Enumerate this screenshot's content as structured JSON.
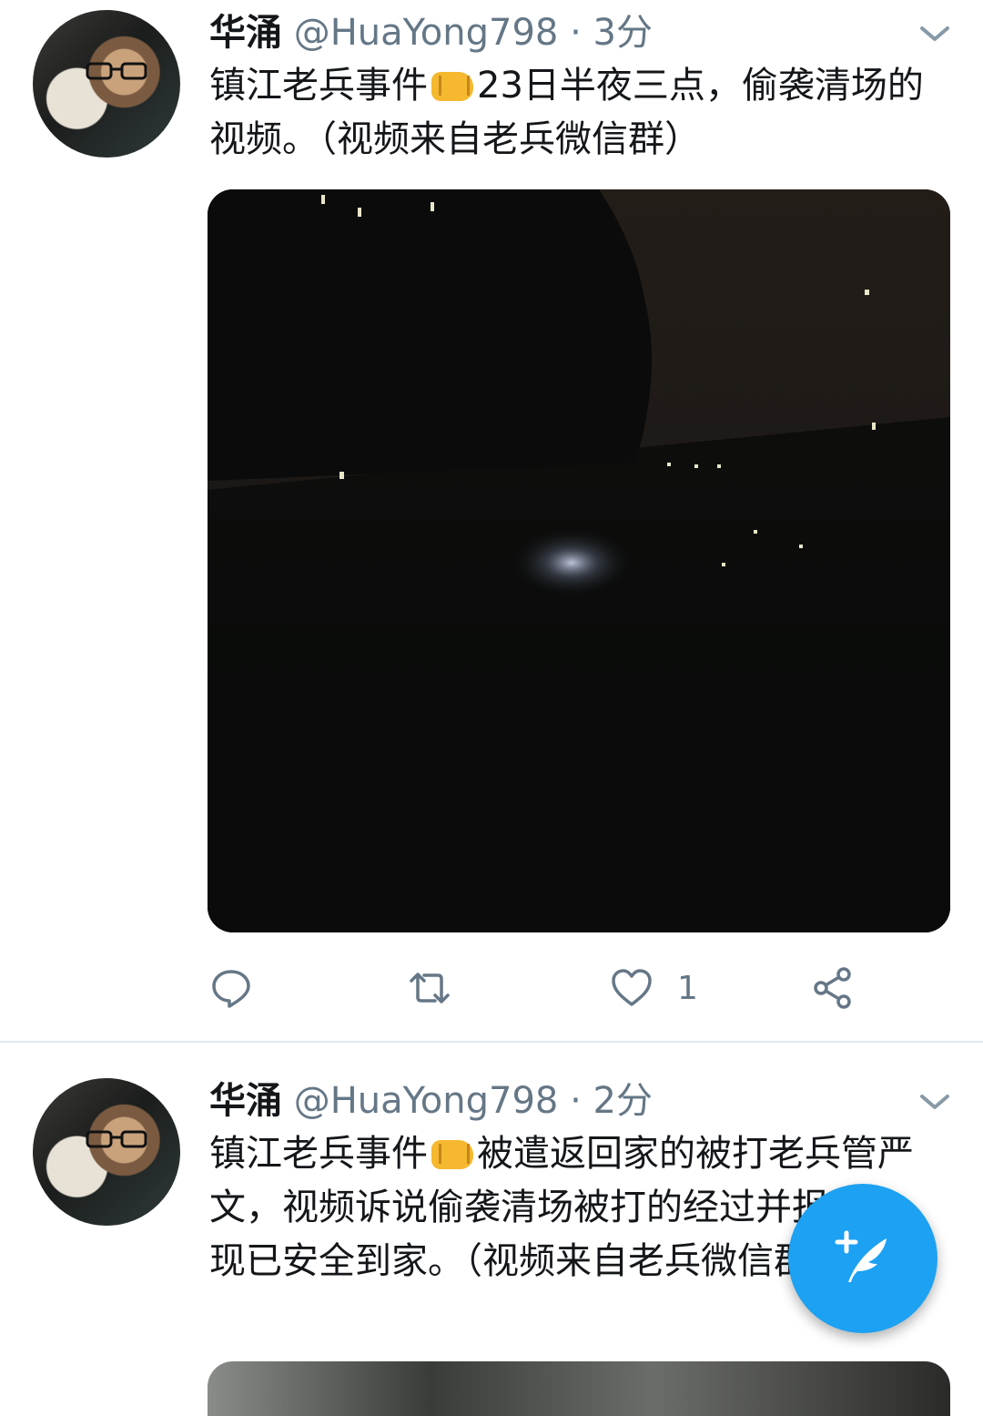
{
  "tweets": [
    {
      "name": "华涌",
      "handle": "@HuaYong798",
      "separator": "·",
      "time": "3分",
      "text_before": "镇江老兵事件",
      "text_after": "23日半夜三点，偷袭清场的视频。（视频来自老兵微信群）",
      "emoji": "fist-icon",
      "like_count": "1"
    },
    {
      "name": "华涌",
      "handle": "@HuaYong798",
      "separator": "·",
      "time": "2分",
      "text_before": "镇江老兵事件",
      "text_after": "被遣返回家的被打老兵管严文，视频诉说偷袭清场被打的经过并报平安，现已安全到家。（视频来自老兵微信群）",
      "emoji": "fist-icon"
    }
  ],
  "colors": {
    "accent": "#1da1f2",
    "icon_gray": "#657786",
    "text": "#14171a"
  },
  "icons": [
    "chevron-down-icon",
    "reply-icon",
    "retweet-icon",
    "heart-icon",
    "share-icon",
    "compose-icon"
  ]
}
